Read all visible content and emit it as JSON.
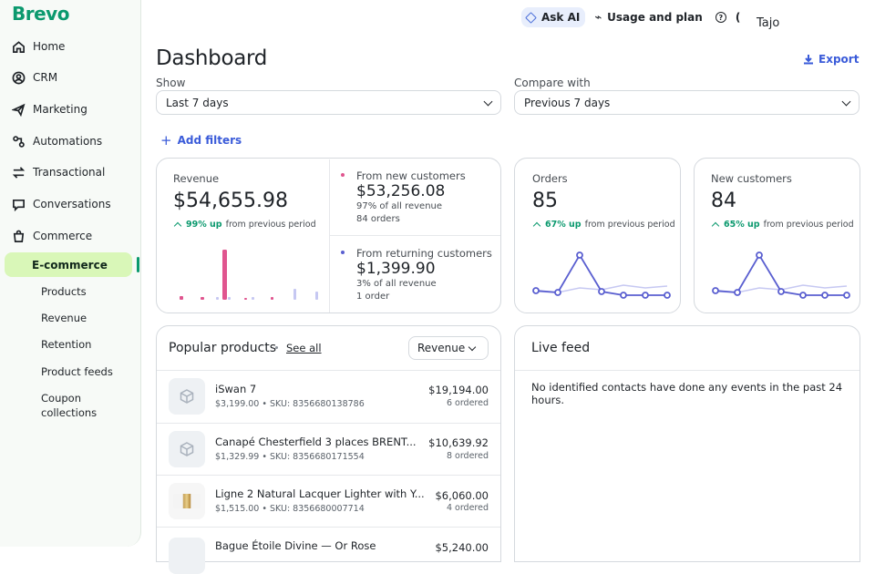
{
  "sidebar": {
    "logo": "Brevo",
    "items": [
      {
        "label": "Home"
      },
      {
        "label": "CRM"
      },
      {
        "label": "Marketing"
      },
      {
        "label": "Automations"
      },
      {
        "label": "Transactional"
      },
      {
        "label": "Conversations"
      },
      {
        "label": "Commerce"
      }
    ],
    "active": "E-commerce",
    "subitems": [
      "Products",
      "Revenue",
      "Retention",
      "Product feeds",
      "Coupon collections"
    ]
  },
  "topbar": {
    "ask_ai": "Ask AI",
    "usage": "Usage and plan",
    "user": "Tajo"
  },
  "header": {
    "title": "Dashboard",
    "export": "Export"
  },
  "filters": {
    "show_label": "Show",
    "show_value": "Last 7 days",
    "compare_label": "Compare with",
    "compare_value": "Previous 7 days",
    "add_filters": "Add filters"
  },
  "revenue": {
    "label": "Revenue",
    "value": "$54,655.98",
    "pct": "99% up",
    "period": "from previous period",
    "new_label": "From new customers",
    "new_value": "$53,256.08",
    "new_pct": "97% of all revenue",
    "new_orders": "84 orders",
    "ret_label": "From returning customers",
    "ret_value": "$1,399.90",
    "ret_pct": "3% of all revenue",
    "ret_orders": "1 order",
    "new_color": "#e0558f",
    "ret_color": "#5a5fd0"
  },
  "orders": {
    "label": "Orders",
    "value": "85",
    "pct": "67% up",
    "period": "from previous period"
  },
  "customers": {
    "label": "New customers",
    "value": "84",
    "pct": "65% up",
    "period": "from previous period"
  },
  "popular": {
    "title": "Popular products",
    "see_all": "See all",
    "sort": "Revenue",
    "products": [
      {
        "name": "iSwan 7",
        "meta": "$3,199.00 • SKU: 8356680138786",
        "amount": "$19,194.00",
        "ordered": "6 ordered"
      },
      {
        "name": "Canapé Chesterfield 3 places BRENT...",
        "meta": "$1,329.99 • SKU: 8356680171554",
        "amount": "$10,639.92",
        "ordered": "8 ordered"
      },
      {
        "name": "Ligne 2 Natural Lacquer Lighter with Y...",
        "meta": "$1,515.00 • SKU: 8356680007714",
        "amount": "$6,060.00",
        "ordered": "4 ordered"
      },
      {
        "name": "Bague Étoile Divine — Or Rose",
        "meta": "",
        "amount": "$5,240.00",
        "ordered": ""
      }
    ]
  },
  "feed": {
    "title": "Live feed",
    "empty": "No identified contacts have done any events in the past 24 hours."
  }
}
